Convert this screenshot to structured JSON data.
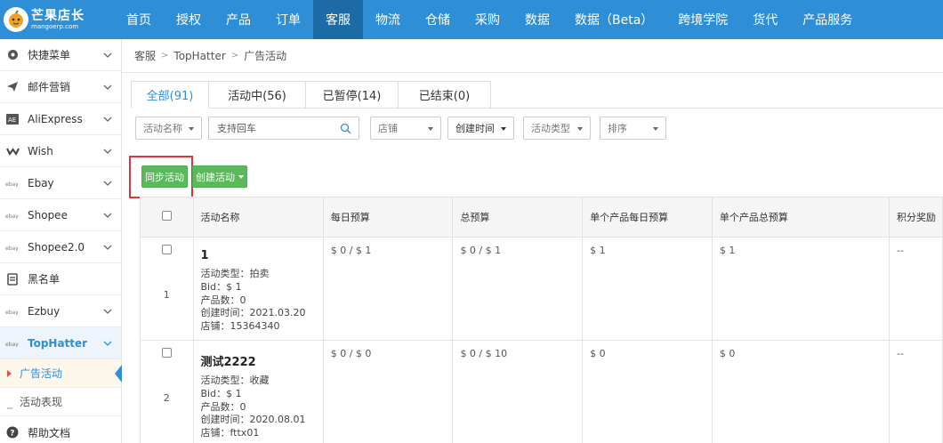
{
  "topnav": {
    "logo_title": "芒果店长",
    "logo_sub": "mangoerp.com",
    "items": [
      "首页",
      "授权",
      "产品",
      "订单",
      "客服",
      "物流",
      "仓储",
      "采购",
      "数据",
      "数据（Beta）",
      "跨境学院",
      "货代",
      "产品服务"
    ],
    "active_index": 4
  },
  "sidebar": {
    "items": [
      {
        "label": "快捷菜单",
        "icon": "shortcut-icon"
      },
      {
        "label": "邮件营销",
        "icon": "paper-plane-icon"
      },
      {
        "label": "AliExpress",
        "icon": "aliexpress-icon"
      },
      {
        "label": "Wish",
        "icon": "wish-icon"
      },
      {
        "label": "Ebay",
        "icon": "ebay-icon"
      },
      {
        "label": "Shopee",
        "icon": "ebay-icon"
      },
      {
        "label": "Shopee2.0",
        "icon": "ebay-icon"
      },
      {
        "label": "黑名单",
        "icon": "blacklist-icon"
      },
      {
        "label": "Ezbuy",
        "icon": "ebay-icon"
      },
      {
        "label": "TopHatter",
        "icon": "ebay-icon"
      }
    ],
    "sub_items": [
      "广告活动",
      "活动表现"
    ],
    "footer": "帮助文档"
  },
  "breadcrumb": [
    "客服",
    "TopHatter",
    "广告活动"
  ],
  "tabs": [
    "全部(91)",
    "活动中(56)",
    "已暂停(14)",
    "已结束(0)"
  ],
  "filters": {
    "name_select": "活动名称",
    "search_placeholder": "支持回车",
    "store": "店铺",
    "created": "创建时间",
    "type": "活动类型",
    "sort": "排序"
  },
  "buttons": {
    "sync": "同步活动",
    "create": "创建活动"
  },
  "table": {
    "headers": [
      "活动名称",
      "每日预算",
      "总预算",
      "单个产品每日预算",
      "单个产品总预算",
      "积分奖励"
    ],
    "rows": [
      {
        "index": "1",
        "name": "1",
        "details": [
          "活动类型：拍卖",
          "Bid：$ 1",
          "产品数：0",
          "创建时间：2021.03.20",
          "店铺：15364340"
        ],
        "daily_budget": "$ 0 / $ 1",
        "total_budget": "$ 0 / $ 1",
        "product_daily": "$ 1",
        "product_total": "$ 1",
        "points": "--"
      },
      {
        "index": "2",
        "name": "测试2222",
        "details": [
          "活动类型：收藏",
          "Bid：$ 1",
          "产品数：0",
          "创建时间：2020.08.01",
          "店铺：fttx01"
        ],
        "daily_budget": "$ 0 / $ 0",
        "total_budget": "$ 0 / $ 10",
        "product_daily": "$ 0",
        "product_total": "$ 0",
        "points": "--"
      }
    ]
  },
  "colors": {
    "nav_blue": "#2f8fd6",
    "nav_active": "#1c6aa6",
    "green_button": "#5cb85c",
    "highlight_red": "#e0343a"
  }
}
